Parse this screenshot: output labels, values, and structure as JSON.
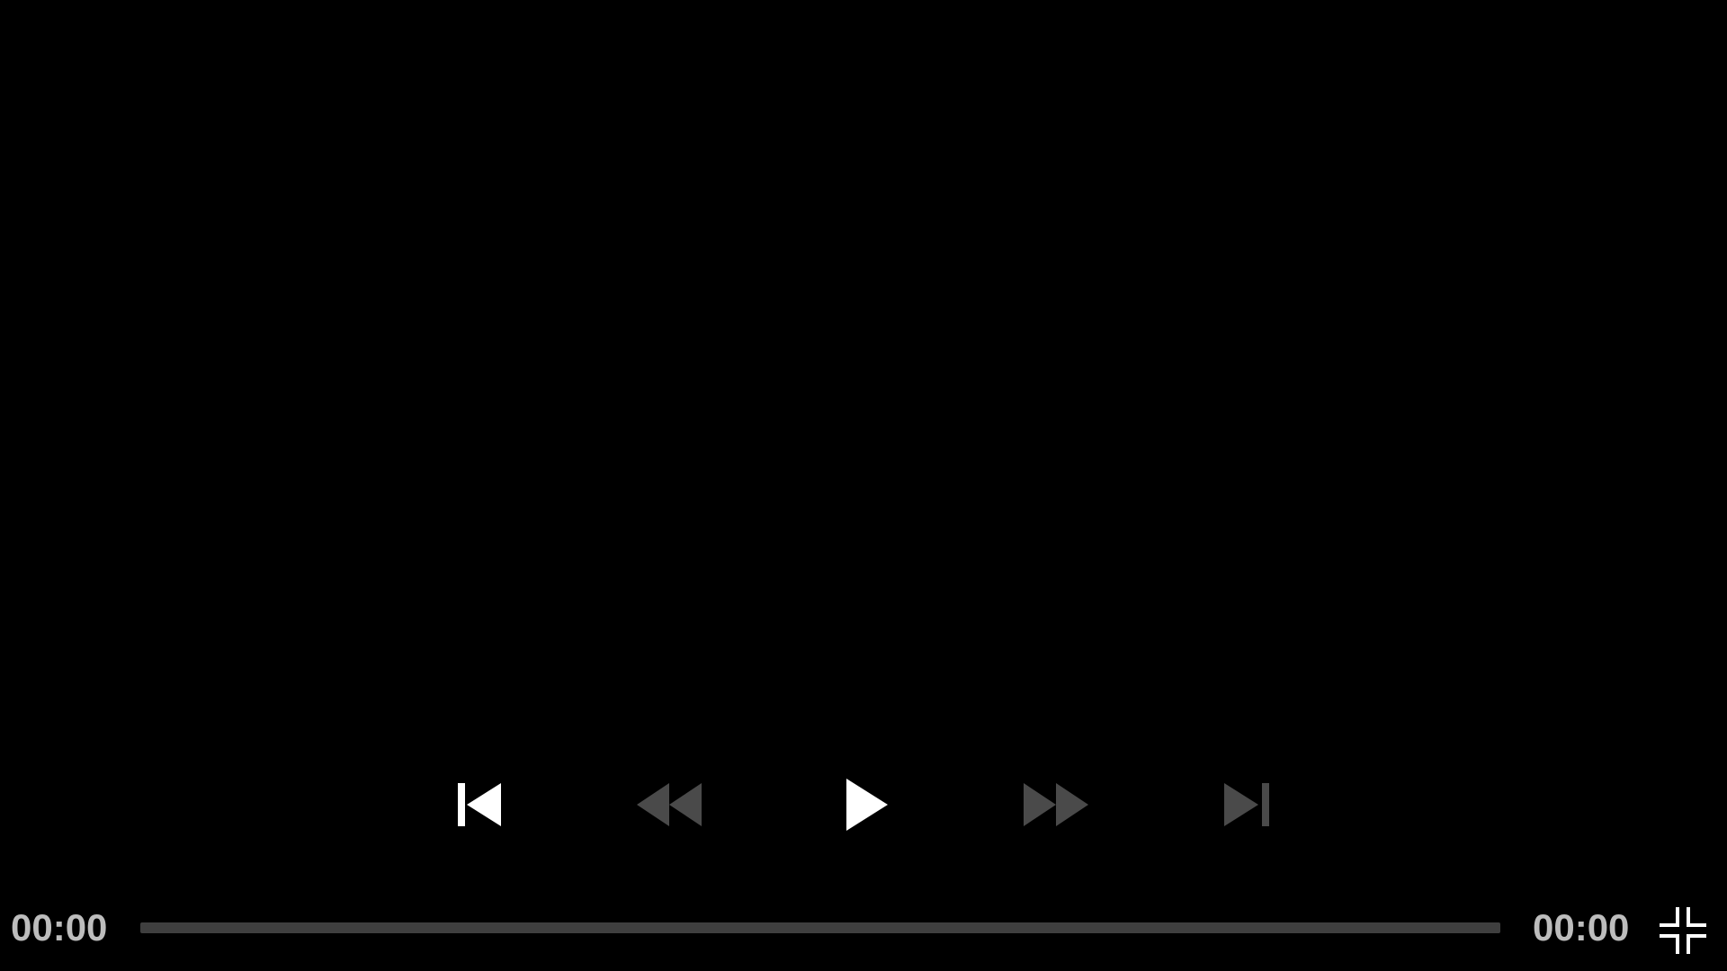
{
  "player": {
    "current_time": "00:00",
    "duration": "00:00",
    "progress_fraction": 0
  },
  "controls": {
    "previous": {
      "icon": "skip-previous-icon",
      "enabled": true
    },
    "rewind": {
      "icon": "rewind-icon",
      "enabled": false
    },
    "play": {
      "icon": "play-icon",
      "enabled": true
    },
    "fast_forward": {
      "icon": "fast-forward-icon",
      "enabled": false
    },
    "next": {
      "icon": "skip-next-icon",
      "enabled": false
    },
    "exit_fullscreen": {
      "icon": "fullscreen-exit-icon",
      "enabled": true
    }
  },
  "colors": {
    "background": "#000000",
    "icon_enabled": "#ffffff",
    "icon_disabled": "#4a4a4a",
    "time_text": "#bdbdbd",
    "seek_track": "#3f3f3f"
  }
}
